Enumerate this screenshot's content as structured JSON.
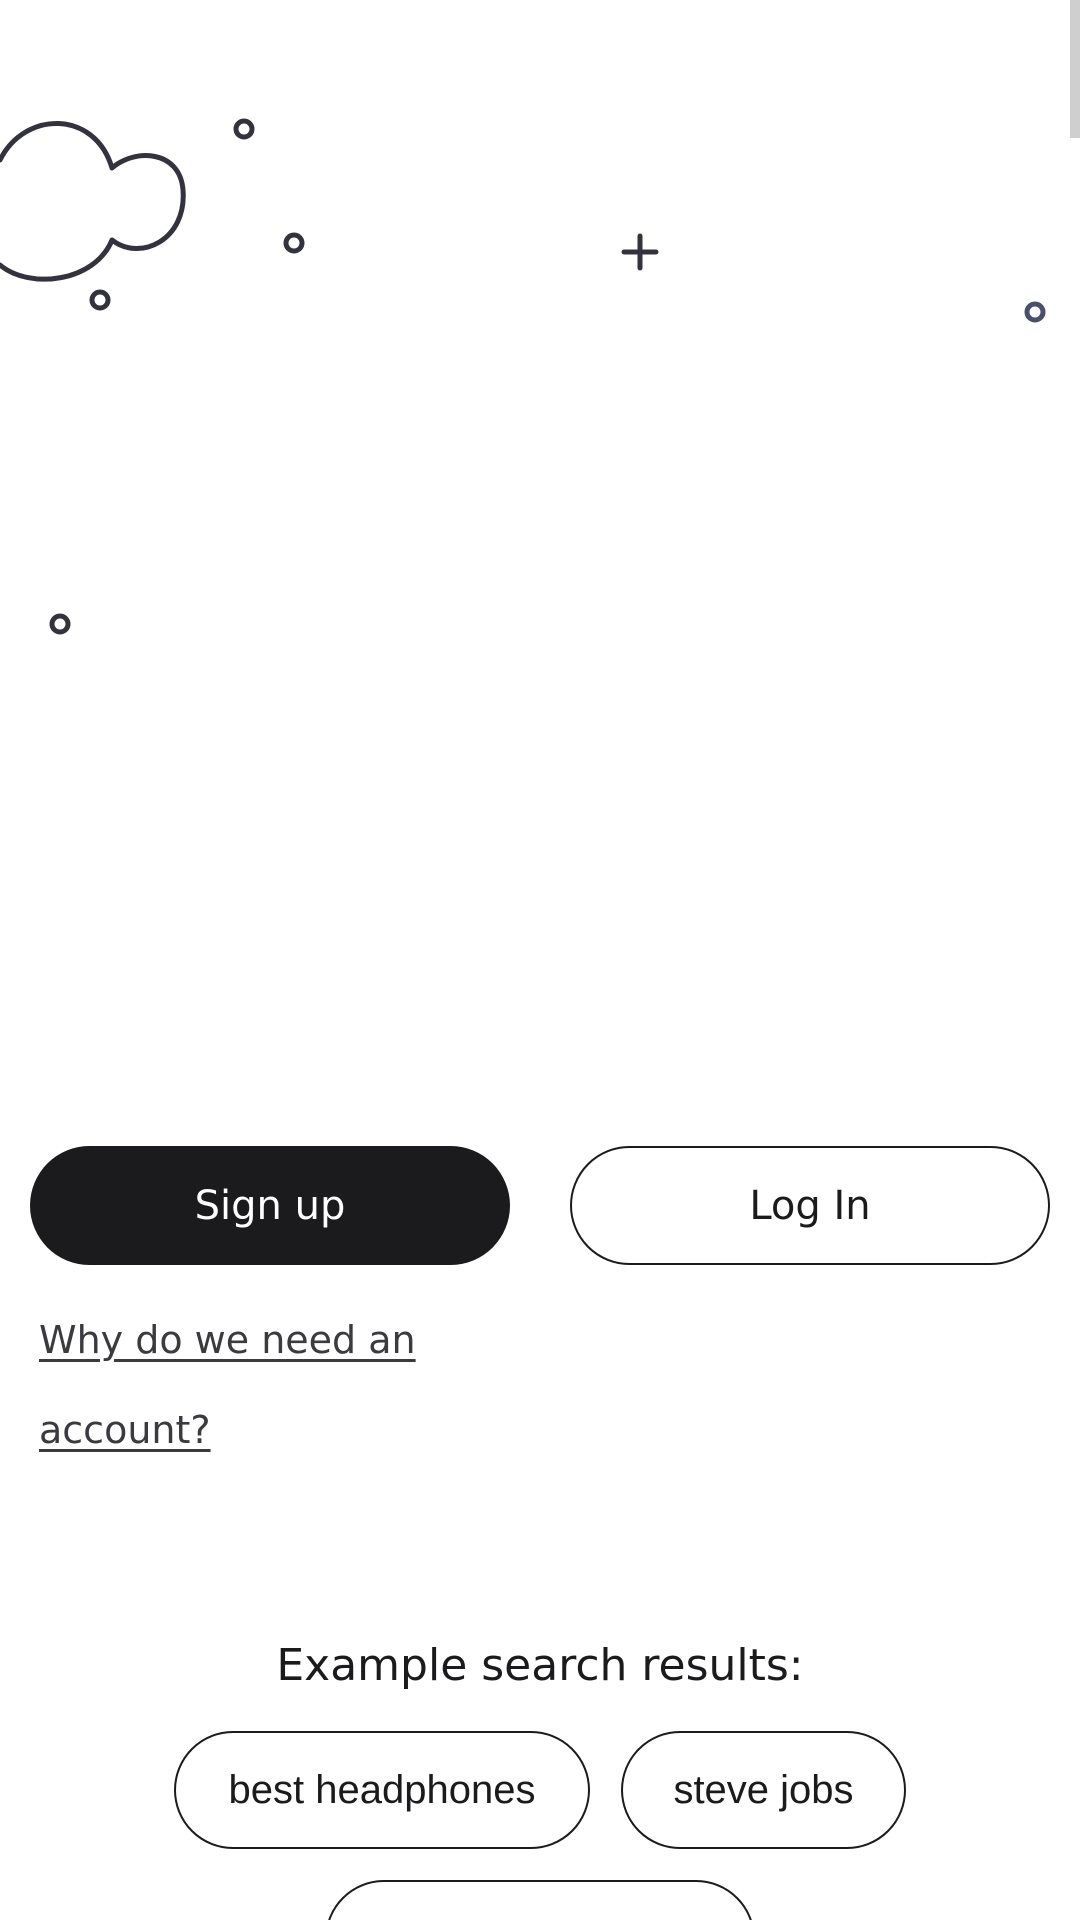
{
  "auth": {
    "signup_label": "Sign up",
    "login_label": "Log In",
    "why_link_label": "Why do we need an account?"
  },
  "examples": {
    "title": "Example search results:",
    "chips": [
      "best headphones",
      "steve jobs",
      ""
    ]
  },
  "colors": {
    "primary_dark": "#1b1b1d",
    "link_gray": "#3b3b3f",
    "decor_stroke": "#33333f"
  },
  "icons": {
    "decor": [
      "cloud-icon",
      "circle-icon",
      "plus-icon"
    ]
  }
}
